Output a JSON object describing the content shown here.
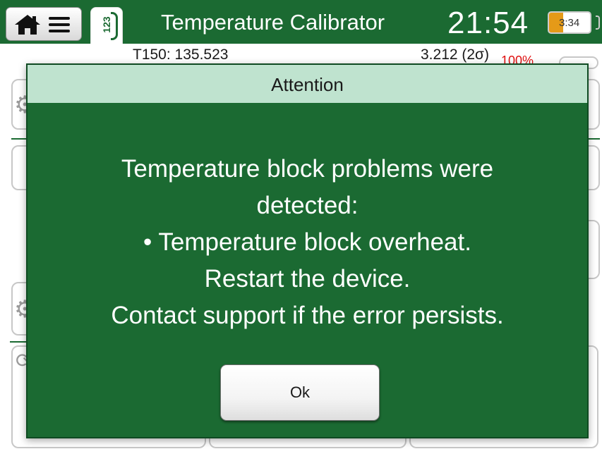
{
  "header": {
    "mode_tab_label": "123",
    "app_title": "Temperature Calibrator",
    "time": "21:54",
    "battery": {
      "time_left": "3:34",
      "level": 0.35,
      "color": "#e59a18"
    }
  },
  "background": {
    "sensor_reading": "T150: 135.523",
    "stability_reading": "3.212 (2σ)",
    "stability_percent": "100%"
  },
  "dialog": {
    "title": "Attention",
    "message_lines": [
      "Temperature block problems were",
      "detected:",
      "• Temperature block overheat.",
      "Restart the device.",
      "Contact support if the error persists."
    ],
    "ok_label": "Ok"
  },
  "colors": {
    "brand_green": "#1b6a32",
    "dialog_header_bg": "#bfe3cf",
    "warning_red": "#e01010"
  }
}
